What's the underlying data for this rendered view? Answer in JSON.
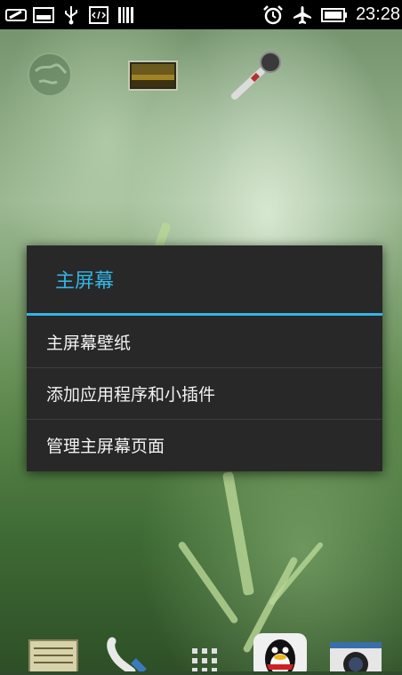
{
  "status_bar": {
    "time": "23:28",
    "left_icons": [
      "usb-storage-icon",
      "image-icon",
      "usb-icon",
      "code-icon",
      "barcode-icon"
    ],
    "right_icons": [
      "alarm-icon",
      "airplane-mode-icon",
      "battery-icon"
    ]
  },
  "home_shortcuts": [
    "globe-icon",
    "gallery-icon",
    "microphone-icon"
  ],
  "context_menu": {
    "title": "主屏幕",
    "items": [
      {
        "label": "主屏幕壁纸"
      },
      {
        "label": "添加应用程序和小插件"
      },
      {
        "label": "管理主屏幕页面"
      }
    ]
  },
  "dock": [
    "notes-icon",
    "phone-icon",
    "app-grid-icon",
    "qq-icon",
    "camera-icon"
  ],
  "colors": {
    "accent": "#33b5e5",
    "menu_background": "#282828",
    "status_bar": "#000000"
  }
}
